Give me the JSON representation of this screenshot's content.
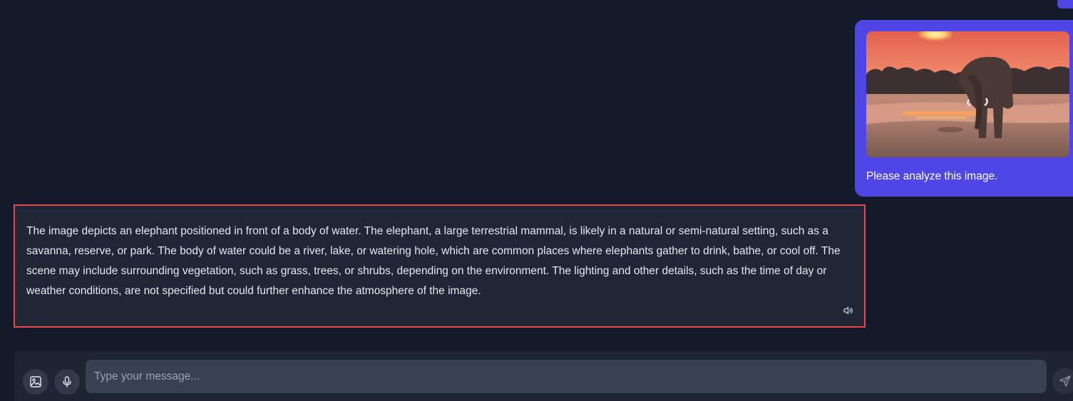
{
  "colors": {
    "background": "#141a29",
    "user_bubble": "#4f46e5",
    "assistant_bubble": "#1f2736",
    "assistant_border": "#e5484d",
    "input_background": "#374151"
  },
  "user_message": {
    "image_icon": "elephant-photo",
    "text": "Please analyze this image."
  },
  "assistant_message": {
    "text": "The image depicts an elephant positioned in front of a body of water. The elephant, a large terrestrial mammal, is likely in a natural or semi-natural setting, such as a savanna, reserve, or park. The body of water could be a river, lake, or watering hole, which are common places where elephants gather to drink, bathe, or cool off. The scene may include surrounding vegetation, such as grass, trees, or shrubs, depending on the environment. The lighting and other details, such as the time of day or weather conditions, are not specified but could further enhance the atmosphere of the image.",
    "speaker_icon": "speaker-icon"
  },
  "composer": {
    "placeholder": "Type your message...",
    "value": "",
    "image_button_icon": "image-icon",
    "mic_button_icon": "microphone-icon",
    "send_button_icon": "send-icon"
  }
}
